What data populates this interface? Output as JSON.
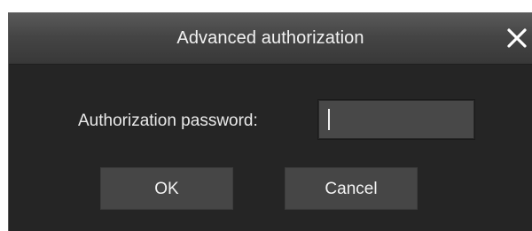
{
  "dialog": {
    "title": "Advanced authorization",
    "close_icon": "close-icon",
    "password_label": "Authorization password:",
    "password_value": "",
    "ok_label": "OK",
    "cancel_label": "Cancel"
  },
  "colors": {
    "dialog_bg": "#252525",
    "titlebar_bg": "#454545",
    "button_bg": "#464646",
    "input_bg": "#484848",
    "text": "#f2f2f2"
  }
}
